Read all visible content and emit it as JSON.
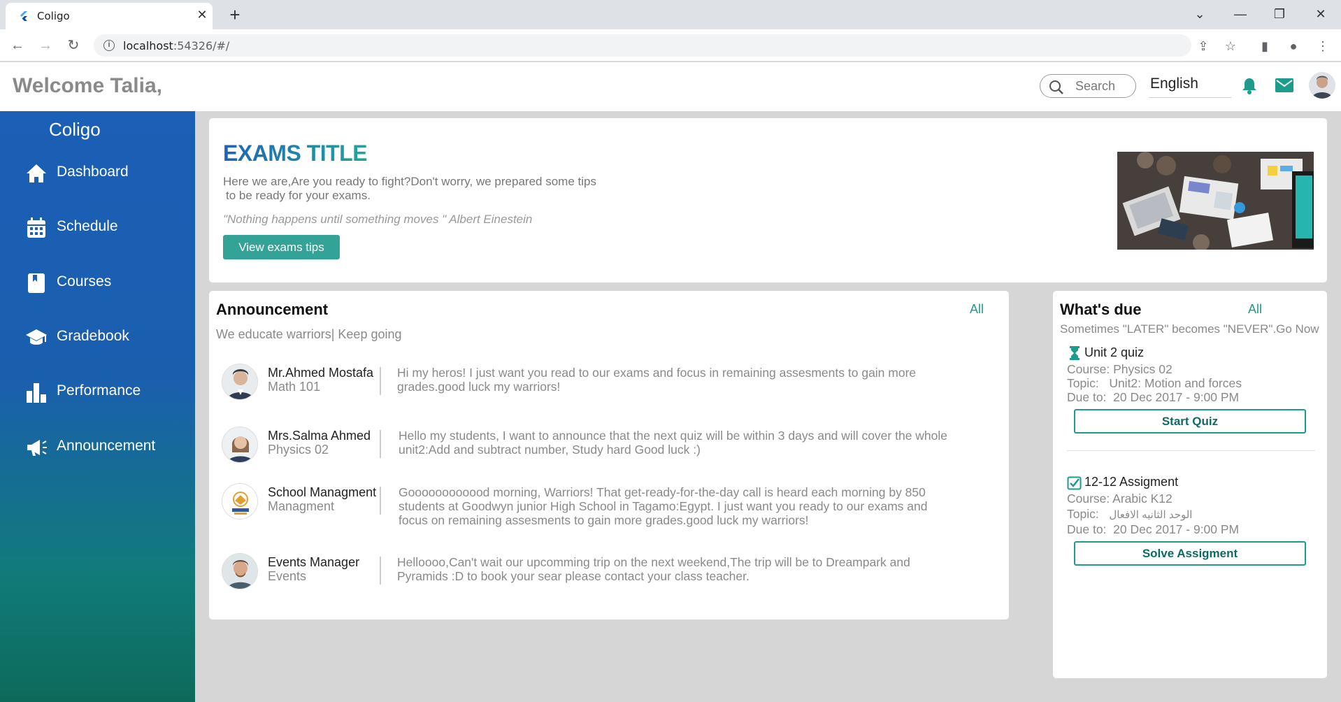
{
  "browser": {
    "tab_title": "Coligo",
    "tab_close": "✕",
    "new_tab": "+",
    "url_host": "localhost",
    "url_rest": ":54326/#/"
  },
  "header": {
    "welcome": "Welcome Talia,",
    "search_placeholder": "Search",
    "language": "English"
  },
  "sidebar": {
    "brand": "Coligo",
    "items": [
      {
        "label": "Dashboard",
        "icon": "home-icon"
      },
      {
        "label": "Schedule",
        "icon": "calendar-icon"
      },
      {
        "label": "Courses",
        "icon": "book-icon"
      },
      {
        "label": "Gradebook",
        "icon": "graduation-cap-icon"
      },
      {
        "label": "Performance",
        "icon": "bar-chart-icon"
      },
      {
        "label": "Announcement",
        "icon": "megaphone-icon"
      }
    ]
  },
  "hero": {
    "title": "EXAMS TITLE",
    "text_line1": "Here we are,Are you ready to fight?Don't worry, we prepared some tips",
    "text_line2": "to be ready for your exams.",
    "quote": "\"Nothing happens until something moves \" Albert Einestein",
    "button": "View exams tips"
  },
  "announcements": {
    "title": "Announcement",
    "all": "All",
    "subtitle": "We educate warriors| Keep going",
    "items": [
      {
        "name": "Mr.Ahmed Mostafa",
        "course": "Math 101",
        "message": "Hi my heros! I just want you read to our exams and focus in remaining assesments to gain more grades.good luck my warriors!"
      },
      {
        "name": "Mrs.Salma Ahmed",
        "course": "Physics 02",
        "message": "Hello my students, I want to announce that the next quiz will be within 3 days and will cover the whole unit2:Add and subtract number, Study hard Good luck :)"
      },
      {
        "name": "School Managment",
        "course": "Managment",
        "message": "Goooooooooood morning,  Warriors! That get-ready-for-the-day call is heard each morning by 850 students at Goodwyn junior High School in Tagamo:Egypt. I just want you ready to our exams and focus on remaining assesments to gain more grades.good luck my warriors!"
      },
      {
        "name": "Events Manager",
        "course": "Events",
        "message": "Helloooo,Can't wait our upcomming trip on the next weekend,The trip will be to Dreampark and Pyramids :D to book your sear please contact your class teacher."
      }
    ]
  },
  "due": {
    "title": "What's due",
    "all": "All",
    "subtitle": "Sometimes \"LATER\" becomes \"NEVER\".Go Now",
    "items": [
      {
        "title": "Unit 2 quiz",
        "course": "Course: Physics 02",
        "topic_label": "Topic:",
        "topic": "Unit2: Motion and forces",
        "due_label": "Due to:",
        "due": "20 Dec 2017 - 9:00 PM",
        "button": "Start Quiz",
        "icon": "hourglass-icon"
      },
      {
        "title": "12-12 Assigment",
        "course": "Course: Arabic K12",
        "topic_label": "Topic:",
        "topic": "الوحد الثانيه الافعال",
        "due_label": "Due to:",
        "due": "20 Dec 2017 - 9:00 PM",
        "button": "Solve Assigment",
        "icon": "checkbox-icon"
      }
    ]
  },
  "colors": {
    "sidebar_top": "#1b5fb6",
    "sidebar_bottom": "#0d6a5a",
    "accent_teal": "#33a397",
    "link_teal": "#1d9b8c"
  }
}
